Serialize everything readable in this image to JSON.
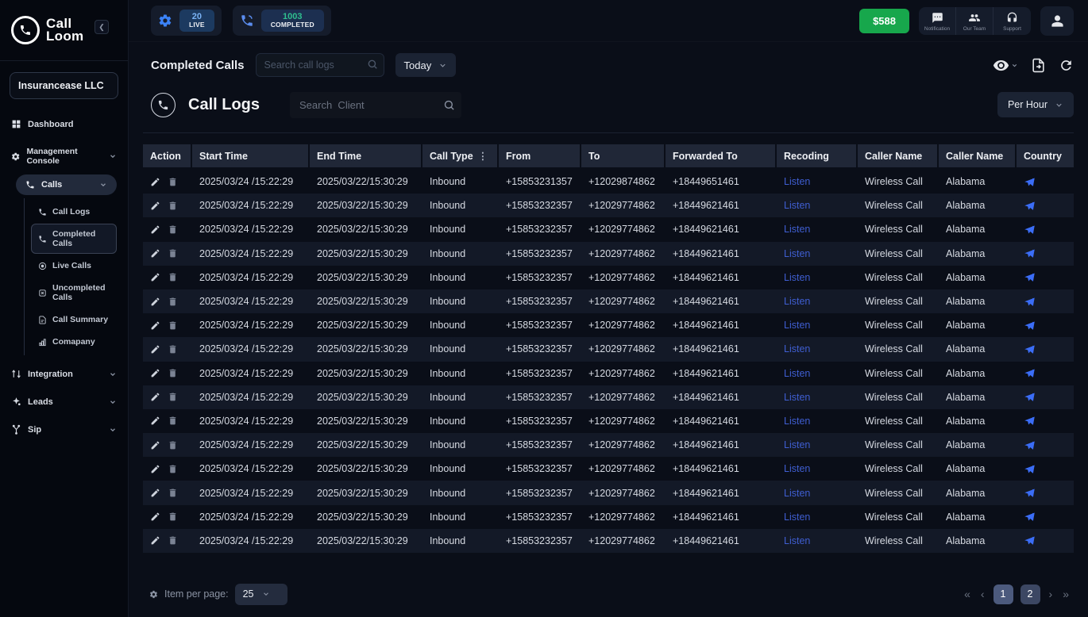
{
  "sidebar": {
    "logo_line1": "Call",
    "logo_line2": "Loom",
    "company": "Insurancease LLC",
    "dashboard": "Dashboard",
    "management_console": "Management Console",
    "calls": "Calls",
    "calls_subitems": [
      "Call Logs",
      "Completed Calls",
      "Live Calls",
      "Uncompleted Calls",
      "Call Summary",
      "Comapany"
    ],
    "integration": "Integration",
    "leads": "Leads",
    "sip": "Sip"
  },
  "topbar": {
    "live_count": "20",
    "live_label": "LIVE",
    "completed_count": "1003",
    "completed_label": "COMPLETED",
    "balance": "$588",
    "notification_label": "Notification",
    "team_label": "Our Team",
    "support_label": "Support"
  },
  "toolbar": {
    "title": "Completed Calls",
    "search_placeholder": "Search call logs",
    "date_filter": "Today"
  },
  "callbar": {
    "title": "Call Logs",
    "search_placeholder": "Search  Client",
    "interval_filter": "Per Hour"
  },
  "table": {
    "columns": [
      "Action",
      "Start Time",
      "End Time",
      "Call Type",
      "From",
      "To",
      "Forwarded To",
      "Recoding",
      "Caller Name",
      "Caller Name",
      "Country"
    ],
    "rows": [
      {
        "start": "2025/03/24 /15:22:29",
        "end": "2025/03/22/15:30:29",
        "type": "Inbound",
        "from": "+15853231357",
        "to": "+12029874862",
        "fwd": "+18449651461",
        "recoding": "Listen",
        "caller1": "Wireless Call",
        "caller2": "Alabama"
      },
      {
        "start": "2025/03/24 /15:22:29",
        "end": "2025/03/22/15:30:29",
        "type": "Inbound",
        "from": "+15853232357",
        "to": "+12029774862",
        "fwd": "+18449621461",
        "recoding": "Listen",
        "caller1": "Wireless Call",
        "caller2": "Alabama"
      },
      {
        "start": "2025/03/24 /15:22:29",
        "end": "2025/03/22/15:30:29",
        "type": "Inbound",
        "from": "+15853232357",
        "to": "+12029774862",
        "fwd": "+18449621461",
        "recoding": "Listen",
        "caller1": "Wireless Call",
        "caller2": "Alabama"
      },
      {
        "start": "2025/03/24 /15:22:29",
        "end": "2025/03/22/15:30:29",
        "type": "Inbound",
        "from": "+15853232357",
        "to": "+12029774862",
        "fwd": "+18449621461",
        "recoding": "Listen",
        "caller1": "Wireless Call",
        "caller2": "Alabama"
      },
      {
        "start": "2025/03/24 /15:22:29",
        "end": "2025/03/22/15:30:29",
        "type": "Inbound",
        "from": "+15853232357",
        "to": "+12029774862",
        "fwd": "+18449621461",
        "recoding": "Listen",
        "caller1": "Wireless Call",
        "caller2": "Alabama"
      },
      {
        "start": "2025/03/24 /15:22:29",
        "end": "2025/03/22/15:30:29",
        "type": "Inbound",
        "from": "+15853232357",
        "to": "+12029774862",
        "fwd": "+18449621461",
        "recoding": "Listen",
        "caller1": "Wireless Call",
        "caller2": "Alabama"
      },
      {
        "start": "2025/03/24 /15:22:29",
        "end": "2025/03/22/15:30:29",
        "type": "Inbound",
        "from": "+15853232357",
        "to": "+12029774862",
        "fwd": "+18449621461",
        "recoding": "Listen",
        "caller1": "Wireless Call",
        "caller2": "Alabama"
      },
      {
        "start": "2025/03/24 /15:22:29",
        "end": "2025/03/22/15:30:29",
        "type": "Inbound",
        "from": "+15853232357",
        "to": "+12029774862",
        "fwd": "+18449621461",
        "recoding": "Listen",
        "caller1": "Wireless Call",
        "caller2": "Alabama"
      },
      {
        "start": "2025/03/24 /15:22:29",
        "end": "2025/03/22/15:30:29",
        "type": "Inbound",
        "from": "+15853232357",
        "to": "+12029774862",
        "fwd": "+18449621461",
        "recoding": "Listen",
        "caller1": "Wireless Call",
        "caller2": "Alabama"
      },
      {
        "start": "2025/03/24 /15:22:29",
        "end": "2025/03/22/15:30:29",
        "type": "Inbound",
        "from": "+15853232357",
        "to": "+12029774862",
        "fwd": "+18449621461",
        "recoding": "Listen",
        "caller1": "Wireless Call",
        "caller2": "Alabama"
      },
      {
        "start": "2025/03/24 /15:22:29",
        "end": "2025/03/22/15:30:29",
        "type": "Inbound",
        "from": "+15853232357",
        "to": "+12029774862",
        "fwd": "+18449621461",
        "recoding": "Listen",
        "caller1": "Wireless Call",
        "caller2": "Alabama"
      },
      {
        "start": "2025/03/24 /15:22:29",
        "end": "2025/03/22/15:30:29",
        "type": "Inbound",
        "from": "+15853232357",
        "to": "+12029774862",
        "fwd": "+18449621461",
        "recoding": "Listen",
        "caller1": "Wireless Call",
        "caller2": "Alabama"
      },
      {
        "start": "2025/03/24 /15:22:29",
        "end": "2025/03/22/15:30:29",
        "type": "Inbound",
        "from": "+15853232357",
        "to": "+12029774862",
        "fwd": "+18449621461",
        "recoding": "Listen",
        "caller1": "Wireless Call",
        "caller2": "Alabama"
      },
      {
        "start": "2025/03/24 /15:22:29",
        "end": "2025/03/22/15:30:29",
        "type": "Inbound",
        "from": "+15853232357",
        "to": "+12029774862",
        "fwd": "+18449621461",
        "recoding": "Listen",
        "caller1": "Wireless Call",
        "caller2": "Alabama"
      },
      {
        "start": "2025/03/24 /15:22:29",
        "end": "2025/03/22/15:30:29",
        "type": "Inbound",
        "from": "+15853232357",
        "to": "+12029774862",
        "fwd": "+18449621461",
        "recoding": "Listen",
        "caller1": "Wireless Call",
        "caller2": "Alabama"
      },
      {
        "start": "2025/03/24 /15:22:29",
        "end": "2025/03/22/15:30:29",
        "type": "Inbound",
        "from": "+15853232357",
        "to": "+12029774862",
        "fwd": "+18449621461",
        "recoding": "Listen",
        "caller1": "Wireless Call",
        "caller2": "Alabama"
      }
    ]
  },
  "footer": {
    "items_per_page_label": "Item per page:",
    "items_per_page_value": "25",
    "pagination": {
      "first": "«",
      "prev": "‹",
      "page1": "1",
      "page2": "2",
      "next": "›",
      "last": "»"
    }
  }
}
